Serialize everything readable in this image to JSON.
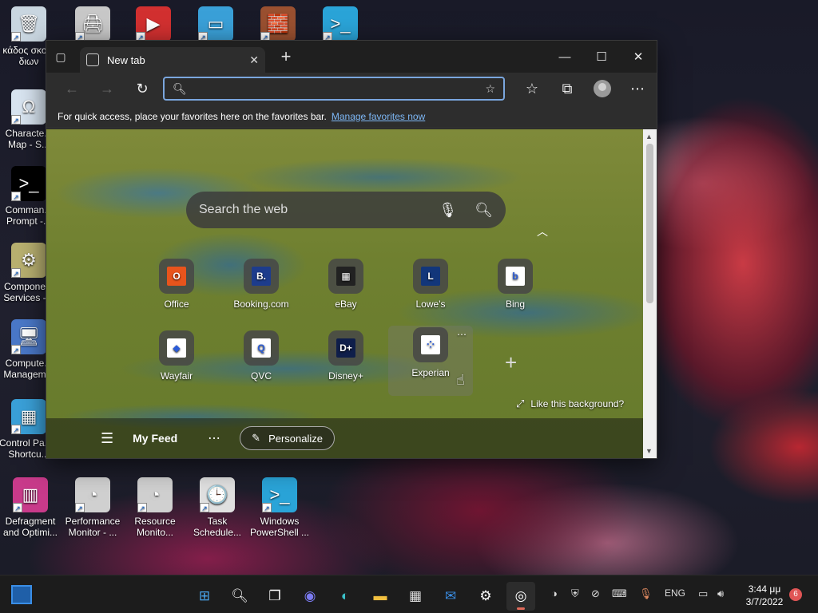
{
  "desktop": {
    "icons_left": [
      {
        "label": "κάδος σκο... διων",
        "icon": "recycle-bin-icon",
        "color": "#c9d6e0",
        "glyph": "🗑"
      },
      {
        "label": "Characte... Map - S...",
        "icon": "character-map-icon",
        "color": "#d8e4f0",
        "glyph": "Ω"
      },
      {
        "label": "Comman... Prompt -...",
        "icon": "command-prompt-icon",
        "color": "#000000",
        "glyph": ">_"
      },
      {
        "label": "Compone... Services -...",
        "icon": "component-services-icon",
        "color": "#b8b070",
        "glyph": "⚙"
      },
      {
        "label": "Compute... Managem...",
        "icon": "computer-management-icon",
        "color": "#4a78c8",
        "glyph": "🖥"
      },
      {
        "label": "Control Pa... - Shortcu...",
        "icon": "control-panel-icon",
        "color": "#3aa0d8",
        "glyph": "▦"
      }
    ],
    "icons_top": [
      {
        "icon": "printer-icon",
        "color": "#c8c8c8",
        "glyph": "🖨"
      },
      {
        "icon": "power-automate-icon",
        "color": "#d23030",
        "glyph": "▶"
      },
      {
        "icon": "remote-desktop-icon",
        "color": "#3aa0d8",
        "glyph": "▭"
      },
      {
        "icon": "firewall-icon",
        "color": "#9a5030",
        "glyph": "🧱"
      },
      {
        "icon": "powershell-icon",
        "color": "#2aa4d8",
        "glyph": ">_"
      }
    ],
    "icons_bottom": [
      {
        "label": "Defragment and Optimi...",
        "icon": "defragment-icon",
        "color": "#c83a8a",
        "glyph": "▥"
      },
      {
        "label": "Performance Monitor - ...",
        "icon": "performance-monitor-icon",
        "color": "#d0d0d0",
        "glyph": "◔"
      },
      {
        "label": "Resource Monito...",
        "icon": "resource-monitor-icon",
        "color": "#d0d0d0",
        "glyph": "◔"
      },
      {
        "label": "Task Schedule...",
        "icon": "task-scheduler-icon",
        "color": "#e0e0e0",
        "glyph": "🕒"
      },
      {
        "label": "Windows PowerShell ...",
        "icon": "windows-powershell-icon",
        "color": "#2aa4d8",
        "glyph": ">_"
      }
    ]
  },
  "browser": {
    "tab_title": "New tab",
    "address": {
      "value": "",
      "placeholder": ""
    },
    "favorites_bar": {
      "message": "For quick access, place your favorites here on the favorites bar.",
      "link": "Manage favorites now"
    },
    "search": {
      "placeholder": "Search the web"
    },
    "tiles": [
      {
        "label": "Office",
        "logo_text": "O",
        "bg": "#e8541c"
      },
      {
        "label": "Booking.com",
        "logo_text": "B.",
        "bg": "#1d3c8c"
      },
      {
        "label": "eBay",
        "logo_text": "▦",
        "bg": "#222222"
      },
      {
        "label": "Lowe's",
        "logo_text": "L",
        "bg": "#12367a"
      },
      {
        "label": "Bing",
        "logo_text": "b",
        "bg": "#ffffff"
      },
      {
        "label": "Wayfair",
        "logo_text": "◆",
        "bg": "#ffffff"
      },
      {
        "label": "QVC",
        "logo_text": "Q",
        "bg": "#ffffff"
      },
      {
        "label": "Disney+",
        "logo_text": "D+",
        "bg": "#0f1e4a"
      },
      {
        "label": "Experian",
        "logo_text": "⁘",
        "bg": "#ffffff"
      }
    ],
    "like_background": "Like this background?",
    "feed": {
      "title": "My Feed",
      "personalize": "Personalize"
    }
  },
  "taskbar": {
    "language": "ENG",
    "time": "3:44 μμ",
    "date": "3/7/2022",
    "notifications": "6"
  },
  "colors": {
    "accent": "#3a8ee6",
    "link": "#7db7f5"
  }
}
